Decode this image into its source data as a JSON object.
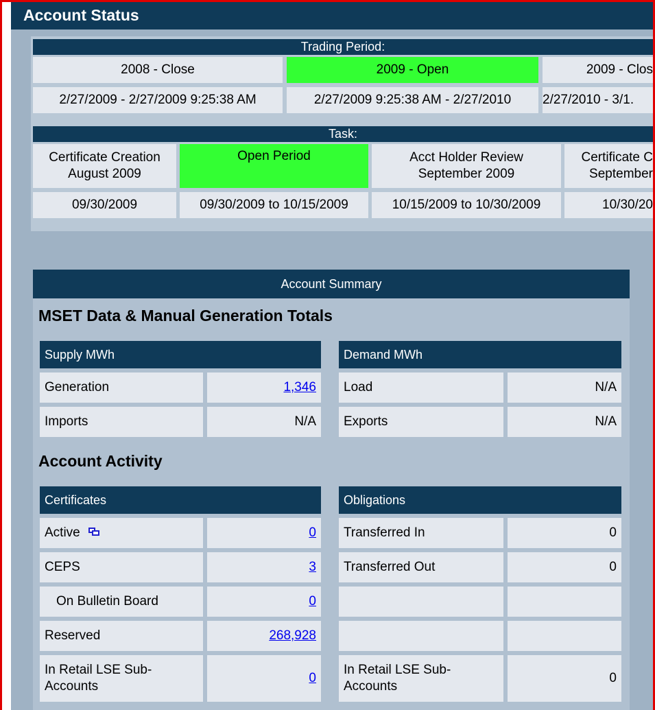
{
  "title": "Account Status",
  "trading": {
    "header": "Trading Period:",
    "periods": [
      {
        "label": "2008 - Close",
        "dates": "2/27/2009 - 2/27/2009 9:25:38 AM",
        "active": false
      },
      {
        "label": "2009 - Open",
        "dates": "2/27/2009 9:25:38 AM - 2/27/2010",
        "active": true
      },
      {
        "label": "2009 - Clos",
        "dates": "2/27/2010 - 3/1.",
        "active": false
      }
    ]
  },
  "task": {
    "header": "Task:",
    "items": [
      {
        "line1": "Certificate Creation",
        "line2": "August 2009",
        "dates": "09/30/2009",
        "active": false
      },
      {
        "line1": "Open Period",
        "line2": "",
        "dates": "09/30/2009 to 10/15/2009",
        "active": true
      },
      {
        "line1": "Acct Holder Review",
        "line2": "September 2009",
        "dates": "10/15/2009 to 10/30/2009",
        "active": false
      },
      {
        "line1": "Certificate C",
        "line2": "September",
        "dates": "10/30/20",
        "active": false
      }
    ]
  },
  "summary": {
    "header": "Account Summary",
    "mset_title": "MSET Data & Manual Generation Totals",
    "supply_header": "Supply MWh",
    "demand_header": "Demand MWh",
    "supply_rows": [
      {
        "label": "Generation",
        "value": "1,346",
        "link": true
      },
      {
        "label": "Imports",
        "value": "N/A",
        "link": false
      }
    ],
    "demand_rows": [
      {
        "label": "Load",
        "value": "N/A"
      },
      {
        "label": "Exports",
        "value": "N/A"
      }
    ],
    "activity_title": "Account Activity",
    "certificates_header": "Certificates",
    "obligations_header": "Obligations",
    "certificate_rows": [
      {
        "label": "Active",
        "value": "0",
        "icon": "group-windows-icon"
      },
      {
        "label": "CEPS",
        "value": "3"
      },
      {
        "label": "On Bulletin Board",
        "value": "0",
        "indent": true
      },
      {
        "label": "Reserved",
        "value": "268,928"
      },
      {
        "label": "In Retail LSE Sub-Accounts",
        "value": "0"
      }
    ],
    "obligation_rows": [
      {
        "label": "Transferred In",
        "value": "0"
      },
      {
        "label": "Transferred Out",
        "value": "0"
      },
      {
        "label": "",
        "value": ""
      },
      {
        "label": "",
        "value": ""
      },
      {
        "label": "In Retail LSE Sub-Accounts",
        "value": "0"
      }
    ]
  }
}
